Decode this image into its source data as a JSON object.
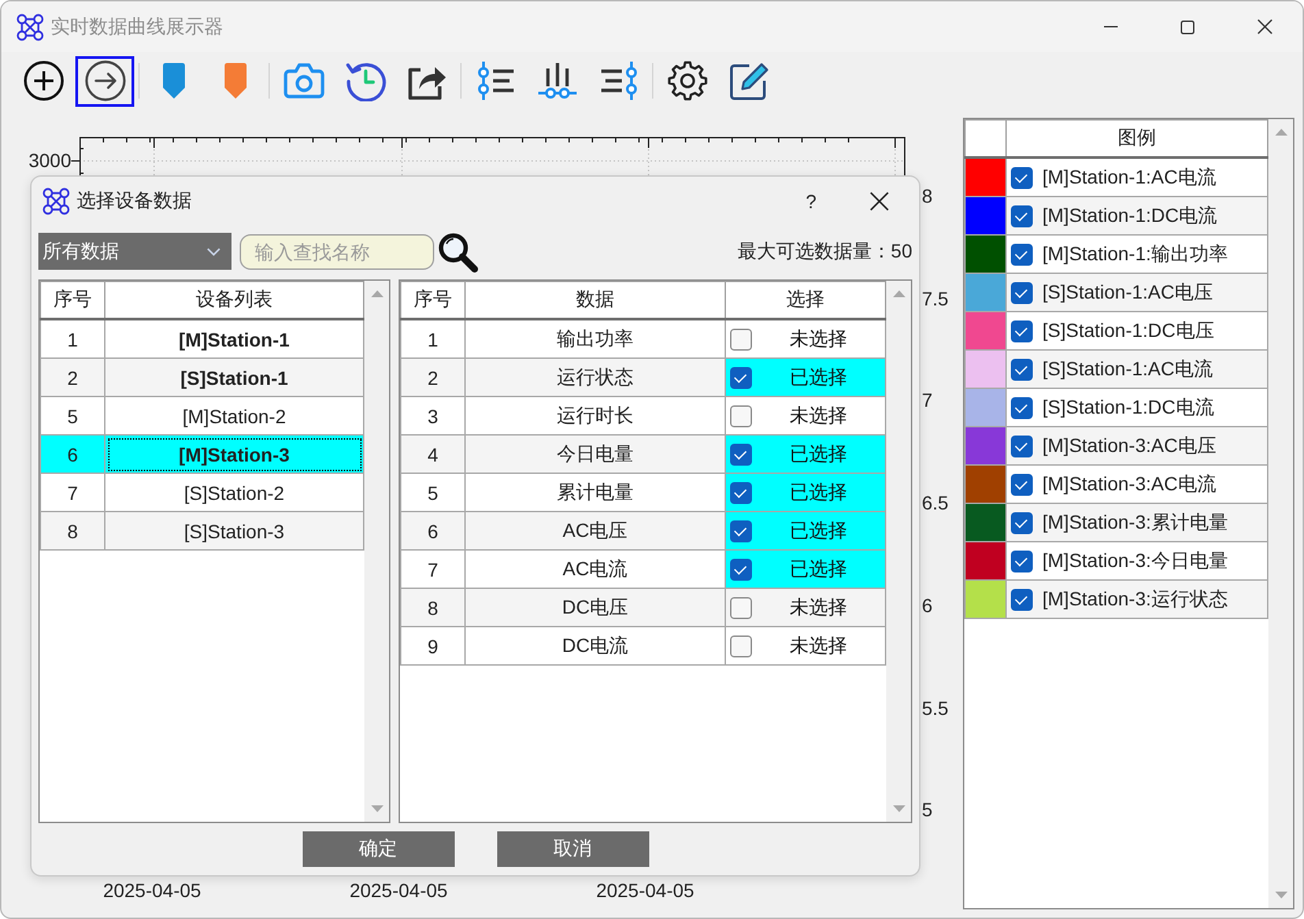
{
  "window": {
    "title": "实时数据曲线展示器"
  },
  "toolbar": {
    "groups": [
      [
        {
          "selected": false
        },
        {
          "selected": true
        }
      ],
      [
        {
          "selected": false
        },
        {
          "selected": false
        }
      ],
      [
        {
          "selected": false
        },
        {
          "selected": false
        },
        {
          "selected": false
        }
      ],
      [
        {
          "selected": false
        },
        {
          "selected": false
        },
        {
          "selected": false
        }
      ],
      [
        {
          "selected": false
        },
        {
          "selected": false
        }
      ]
    ]
  },
  "chart": {
    "left_ticks": [
      "3000"
    ],
    "right_ticks": [
      "8",
      "7.5",
      "7",
      "6.5",
      "6",
      "5.5",
      "5"
    ],
    "x_ticks": [
      "2025-04-05",
      "2025-04-05",
      "2025-04-05"
    ]
  },
  "legend": {
    "header": "图例",
    "rows": [
      {
        "color": "#ff0000",
        "checked": true,
        "label": "[M]Station-1:AC电流"
      },
      {
        "color": "#0000ff",
        "checked": true,
        "label": "[M]Station-1:DC电流"
      },
      {
        "color": "#005000",
        "checked": true,
        "label": "[M]Station-1:输出功率"
      },
      {
        "color": "#4aa8d8",
        "checked": true,
        "label": "[S]Station-1:AC电压"
      },
      {
        "color": "#f04890",
        "checked": true,
        "label": "[S]Station-1:DC电压"
      },
      {
        "color": "#ecc0f0",
        "checked": true,
        "label": "[S]Station-1:AC电流"
      },
      {
        "color": "#a8b4e8",
        "checked": true,
        "label": "[S]Station-1:DC电流"
      },
      {
        "color": "#8838d8",
        "checked": true,
        "label": "[M]Station-3:AC电压"
      },
      {
        "color": "#a04000",
        "checked": true,
        "label": "[M]Station-3:AC电流"
      },
      {
        "color": "#085a20",
        "checked": true,
        "label": "[M]Station-3:累计电量"
      },
      {
        "color": "#c00020",
        "checked": true,
        "label": "[M]Station-3:今日电量"
      },
      {
        "color": "#b4e04a",
        "checked": true,
        "label": "[M]Station-3:运行状态"
      }
    ]
  },
  "dialog": {
    "title": "选择设备数据",
    "help": "?",
    "filter": {
      "value": "所有数据"
    },
    "search": {
      "placeholder": "输入查找名称"
    },
    "limit_text": "最大可选数据量：50",
    "device_table": {
      "columns": [
        "序号",
        "设备列表"
      ],
      "rows": [
        {
          "no": "1",
          "name": "[M]Station-1",
          "bold": true,
          "selected": false
        },
        {
          "no": "2",
          "name": "[S]Station-1",
          "bold": true,
          "selected": false
        },
        {
          "no": "5",
          "name": "[M]Station-2",
          "bold": false,
          "selected": false
        },
        {
          "no": "6",
          "name": "[M]Station-3",
          "bold": true,
          "selected": true
        },
        {
          "no": "7",
          "name": "[S]Station-2",
          "bold": false,
          "selected": false
        },
        {
          "no": "8",
          "name": "[S]Station-3",
          "bold": false,
          "selected": false
        }
      ]
    },
    "data_table": {
      "columns": [
        "序号",
        "数据",
        "选择"
      ],
      "rows": [
        {
          "no": "1",
          "name": "输出功率",
          "checked": false,
          "status": "未选择"
        },
        {
          "no": "2",
          "name": "运行状态",
          "checked": true,
          "status": "已选择"
        },
        {
          "no": "3",
          "name": "运行时长",
          "checked": false,
          "status": "未选择"
        },
        {
          "no": "4",
          "name": "今日电量",
          "checked": true,
          "status": "已选择"
        },
        {
          "no": "5",
          "name": "累计电量",
          "checked": true,
          "status": "已选择"
        },
        {
          "no": "6",
          "name": "AC电压",
          "checked": true,
          "status": "已选择"
        },
        {
          "no": "7",
          "name": "AC电流",
          "checked": true,
          "status": "已选择"
        },
        {
          "no": "8",
          "name": "DC电压",
          "checked": false,
          "status": "未选择"
        },
        {
          "no": "9",
          "name": "DC电流",
          "checked": false,
          "status": "未选择"
        }
      ]
    },
    "buttons": [
      "确定",
      "取消"
    ]
  }
}
